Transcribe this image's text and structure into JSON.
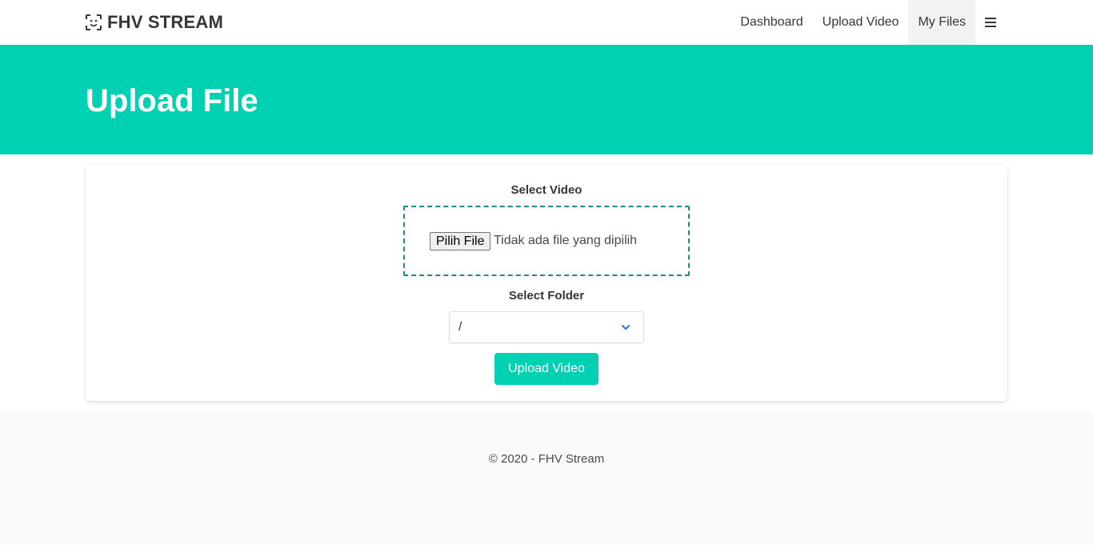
{
  "navbar": {
    "brand": "FHV STREAM",
    "brand_icon": "face-scan-icon",
    "items": [
      {
        "label": "Dashboard",
        "active": false
      },
      {
        "label": "Upload Video",
        "active": false
      },
      {
        "label": "My Files",
        "active": true
      }
    ],
    "menu_icon": "hamburger-menu-icon"
  },
  "hero": {
    "title": "Upload File",
    "background": "#00d1b2"
  },
  "form": {
    "video_label": "Select Video",
    "file_button_label": "Pilih File",
    "file_status": "Tidak ada file yang dipilih",
    "folder_label": "Select Folder",
    "folder_selected": "/",
    "submit_label": "Upload Video"
  },
  "footer": {
    "text": "© 2020 - FHV Stream"
  },
  "colors": {
    "primary": "#00d1b2",
    "dropzone_border": "#1f8a7f",
    "chevron": "#3273dc"
  }
}
